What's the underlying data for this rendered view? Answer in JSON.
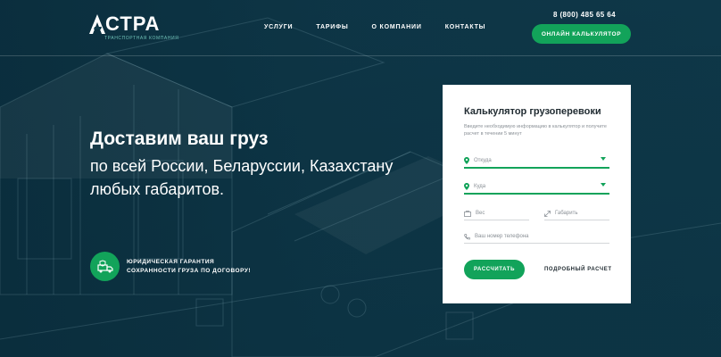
{
  "brand": {
    "name": "СТРА",
    "tagline": "ТРАНСПОРТНАЯ КОМПАНИЯ"
  },
  "nav": {
    "items": [
      "УСЛУГИ",
      "ТАРИФЫ",
      "О КОМПАНИИ",
      "КОНТАКТЫ"
    ]
  },
  "header": {
    "phone": "8 (800) 485 65 64",
    "cta_label": "ОНЛАЙН КАЛЬКУЛЯТОР"
  },
  "hero": {
    "title": "Доставим ваш груз",
    "subtitle": "по всей России, Беларуссии, Казахстану любых габаритов."
  },
  "guarantee": {
    "line1": "ЮРИДИЧЕСКАЯ ГАРАНТИЯ",
    "line2": "СОХРАННОСТИ ГРУЗА ПО ДОГОВОРУ!"
  },
  "calculator": {
    "title": "Калькулятор грузоперевоки",
    "note": "Введите необходимую информацию в калькулятор и получите расчет в течении 5 минут",
    "from_placeholder": "Откуда",
    "to_placeholder": "Куда",
    "weight_placeholder": "Вес",
    "size_placeholder": "Габарить",
    "phone_placeholder": "Ваш номер телефона",
    "submit_label": "РАССЧИТАТЬ",
    "detail_link": "ПОДРОБНЫЙ РАСЧЕТ"
  },
  "colors": {
    "accent": "#12a35a",
    "background": "#0f3a4a"
  }
}
